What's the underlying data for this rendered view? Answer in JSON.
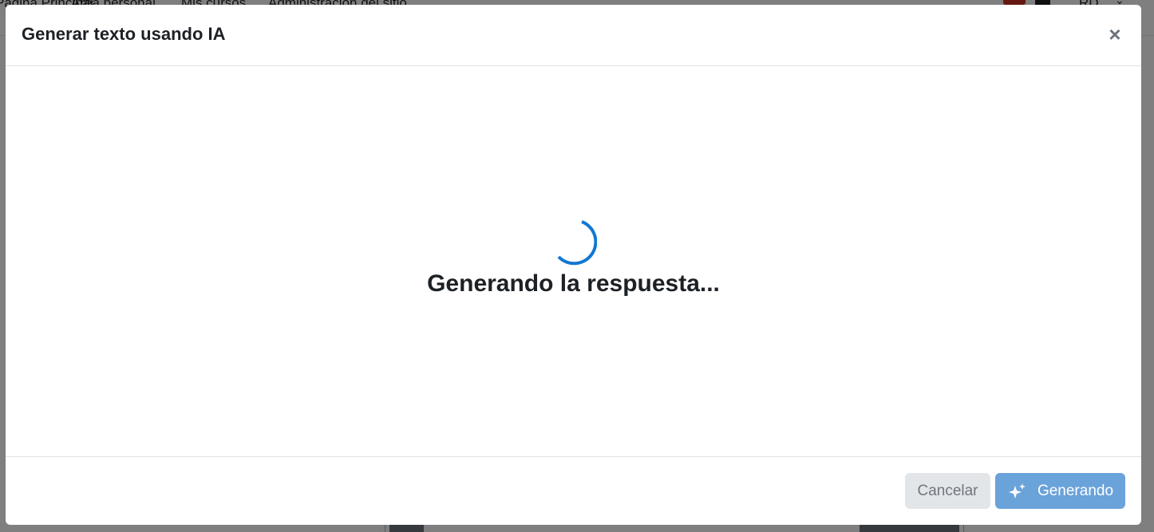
{
  "background": {
    "nav_items": [
      "Página Principal",
      "Área personal",
      "Mis cursos",
      "Administración del sitio"
    ],
    "user_initials": "RD"
  },
  "modal": {
    "title": "Generar texto usando IA",
    "close_symbol": "×",
    "close_icon": "close-icon",
    "loading_text": "Generando la respuesta...",
    "spinner_icon": "loading-spinner-icon",
    "accent_color": "#1177d1",
    "footer": {
      "cancel_label": "Cancelar",
      "generate_label": "Generando",
      "generate_icon": "sparkles-icon",
      "generate_color": "#6aa2da"
    }
  }
}
